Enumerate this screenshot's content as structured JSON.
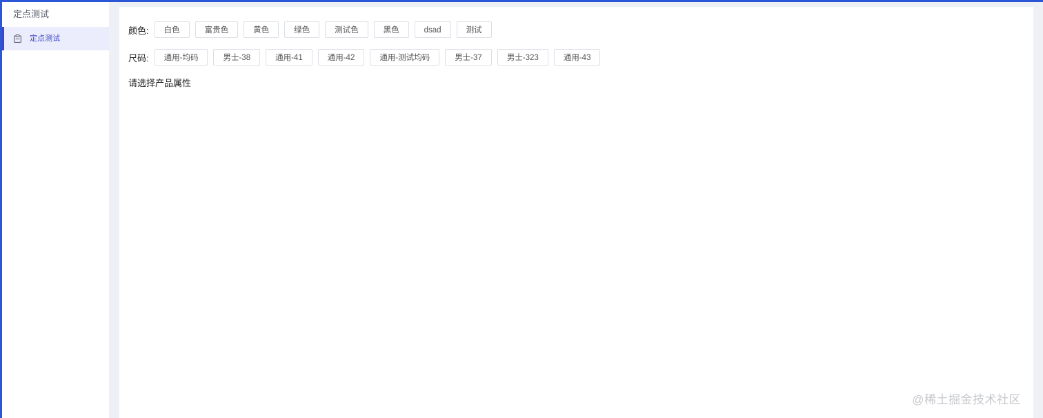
{
  "sidebar": {
    "title": "定点测试",
    "items": [
      {
        "label": "定点测试",
        "icon": "clipboard-icon",
        "active": true
      }
    ]
  },
  "attributes": {
    "color": {
      "label": "颜色:",
      "options": [
        "白色",
        "富贵色",
        "黄色",
        "绿色",
        "测试色",
        "黑色",
        "dsad",
        "测试"
      ]
    },
    "size": {
      "label": "尺码:",
      "options": [
        "通用-均码",
        "男士-38",
        "通用-41",
        "通用-42",
        "通用-测试均码",
        "男士-37",
        "男士-323",
        "通用-43"
      ]
    }
  },
  "prompt": "请选择产品属性",
  "watermark": "@稀土掘金技术社区",
  "colors": {
    "accent": "#2b56d6",
    "active_item_bg": "#ebedfc",
    "active_item_text": "#3c46c8",
    "page_bg": "#eef0f5"
  }
}
